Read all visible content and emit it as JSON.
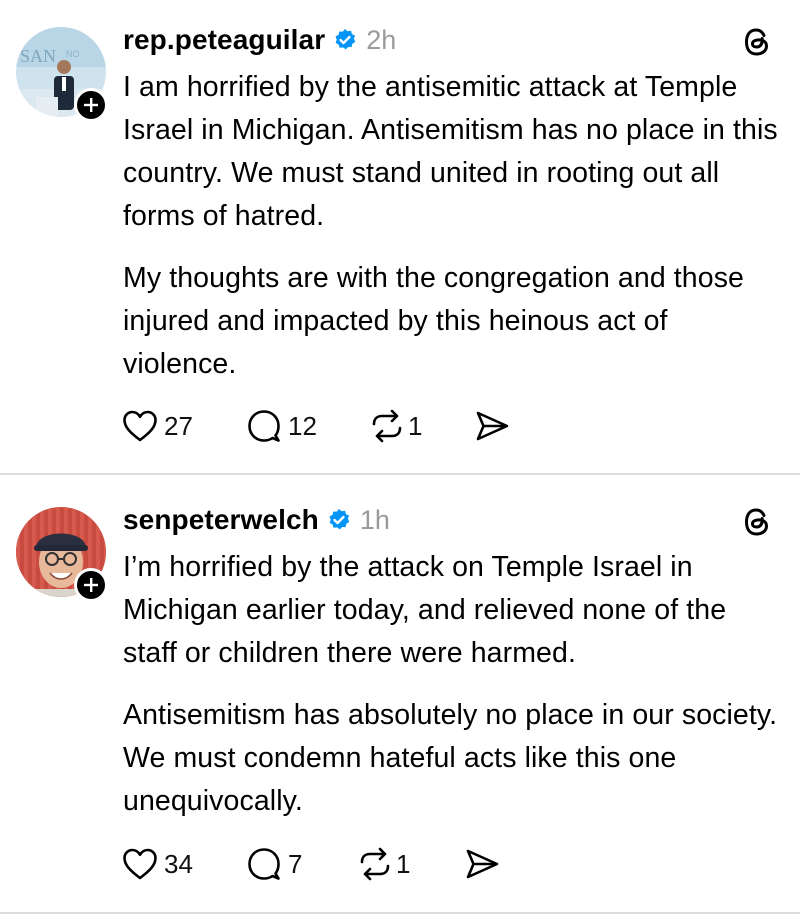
{
  "posts": [
    {
      "username": "rep.peteaguilar",
      "verified": true,
      "timestamp": "2h",
      "paragraphs": [
        "I am horrified by the antisemitic attack at Temple Israel in Michigan. Antisemitism has no place in this country. We must stand united in rooting out all forms of hatred.",
        "My thoughts are with the congregation and those injured and impacted by this heinous act of violence."
      ],
      "likes": "27",
      "replies": "12",
      "reposts": "1"
    },
    {
      "username": "senpeterwelch",
      "verified": true,
      "timestamp": "1h",
      "paragraphs": [
        "I’m horrified by the attack on Temple Israel in Michigan earlier today, and relieved none of the staff or children there were harmed.",
        "Antisemitism has absolutely no place in our society. We must condemn hateful acts like this one unequivocally."
      ],
      "likes": "34",
      "replies": "7",
      "reposts": "1"
    }
  ],
  "icons": {
    "verified": "verified-badge-icon",
    "threads": "threads-logo-icon",
    "like": "heart-icon",
    "reply": "speech-bubble-icon",
    "repost": "repost-icon",
    "share": "send-icon",
    "follow": "plus-icon"
  },
  "colors": {
    "verified_blue": "#0095f6",
    "timestamp_gray": "#9a9a9a",
    "divider": "#dcdcdc"
  }
}
